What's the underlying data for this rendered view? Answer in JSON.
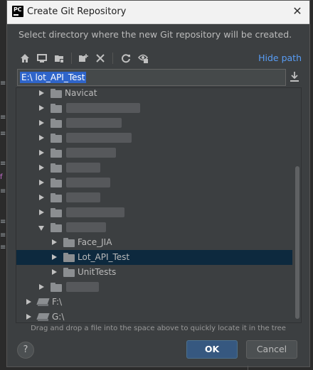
{
  "window": {
    "title": "Create Git Repository",
    "app_icon": "pycharm-icon"
  },
  "instruction": "Select directory where the new Git repository will be created.",
  "toolbar": {
    "buttons": [
      "home-icon",
      "desktop-icon",
      "project-icon",
      "new-folder-icon",
      "delete-icon",
      "refresh-icon",
      "show-hidden-icon"
    ],
    "hide_path_label": "Hide path"
  },
  "path_field": {
    "value": "E:\\        lot_API_Test"
  },
  "tree": {
    "rows": [
      {
        "label": "Navicat",
        "level": 1,
        "expanded": false
      },
      {
        "label": "",
        "level": 1,
        "expanded": false
      },
      {
        "label": "",
        "level": 1,
        "expanded": false
      },
      {
        "label": "",
        "level": 1,
        "expanded": false
      },
      {
        "label": "",
        "level": 1,
        "expanded": false
      },
      {
        "label": "",
        "level": 1,
        "expanded": false
      },
      {
        "label": "",
        "level": 1,
        "expanded": false
      },
      {
        "label": "",
        "level": 1,
        "expanded": false
      },
      {
        "label": "",
        "level": 1,
        "expanded": false
      },
      {
        "label": "",
        "level": 1,
        "expanded": true
      },
      {
        "label": "Face_JIA",
        "level": 2,
        "expanded": false
      },
      {
        "label": "Lot_API_Test",
        "level": 2,
        "expanded": false,
        "selected": true
      },
      {
        "label": "UnitTests",
        "level": 2,
        "expanded": false
      },
      {
        "label": "",
        "level": 1,
        "expanded": false
      },
      {
        "label": "F:\\",
        "level": 0,
        "expanded": false
      },
      {
        "label": "G:\\",
        "level": 0,
        "expanded": false
      }
    ]
  },
  "hint": "Drag and drop a file into the space above to quickly locate it in the tree",
  "buttons": {
    "help": "?",
    "ok": "OK",
    "cancel": "Cancel"
  },
  "colors": {
    "dialog_bg": "#3c3f41",
    "accent_link": "#589df6",
    "selection": "#2f65ca",
    "tree_selection": "#0d293e",
    "ok_bg": "#365880"
  }
}
